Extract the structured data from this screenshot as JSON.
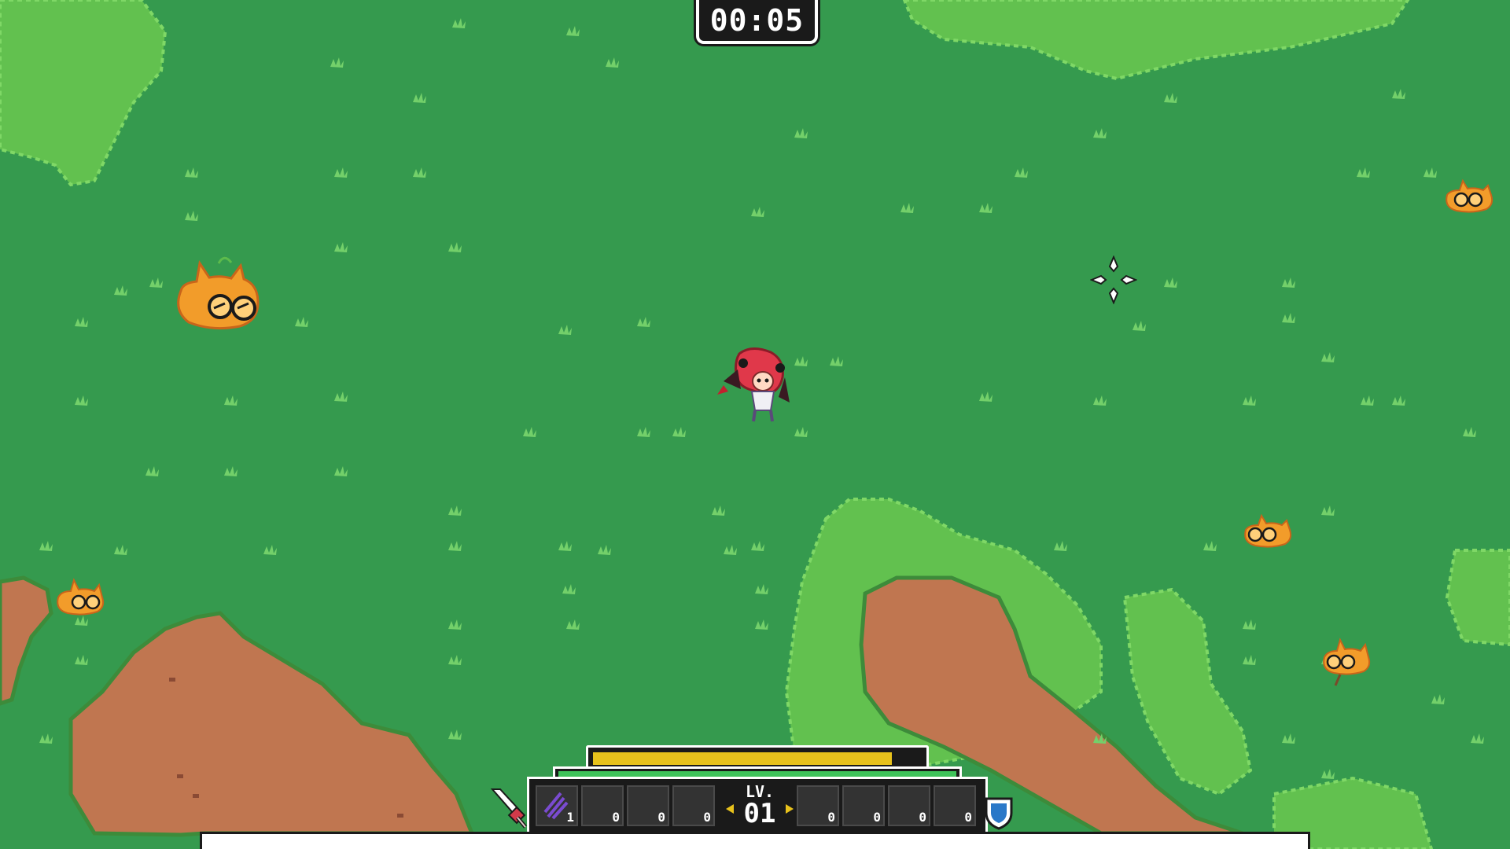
{
  "hud": {
    "timer": "00:05",
    "level_label": "LV.",
    "level_value": "01",
    "xp_fraction": 0.91,
    "hp_fraction": 1.0,
    "weapon_slots": [
      {
        "icon": "purple-claw-icon",
        "count": "1",
        "filled": true
      },
      {
        "icon": "",
        "count": "0",
        "filled": false
      },
      {
        "icon": "",
        "count": "0",
        "filled": false
      },
      {
        "icon": "",
        "count": "0",
        "filled": false
      }
    ],
    "passive_slots": [
      {
        "icon": "",
        "count": "0",
        "filled": false
      },
      {
        "icon": "",
        "count": "0",
        "filled": false
      },
      {
        "icon": "",
        "count": "0",
        "filled": false
      },
      {
        "icon": "",
        "count": "0",
        "filled": false
      }
    ],
    "weapon_category_icon": "sword-icon",
    "passive_category_icon": "shield-icon"
  },
  "colors": {
    "grass": "#359a4e",
    "bush": "#6fcf55",
    "dirt": "#c07650",
    "xp": "#e8c21c",
    "hp": "#3fc35a",
    "enemy": "#f29c2a"
  }
}
